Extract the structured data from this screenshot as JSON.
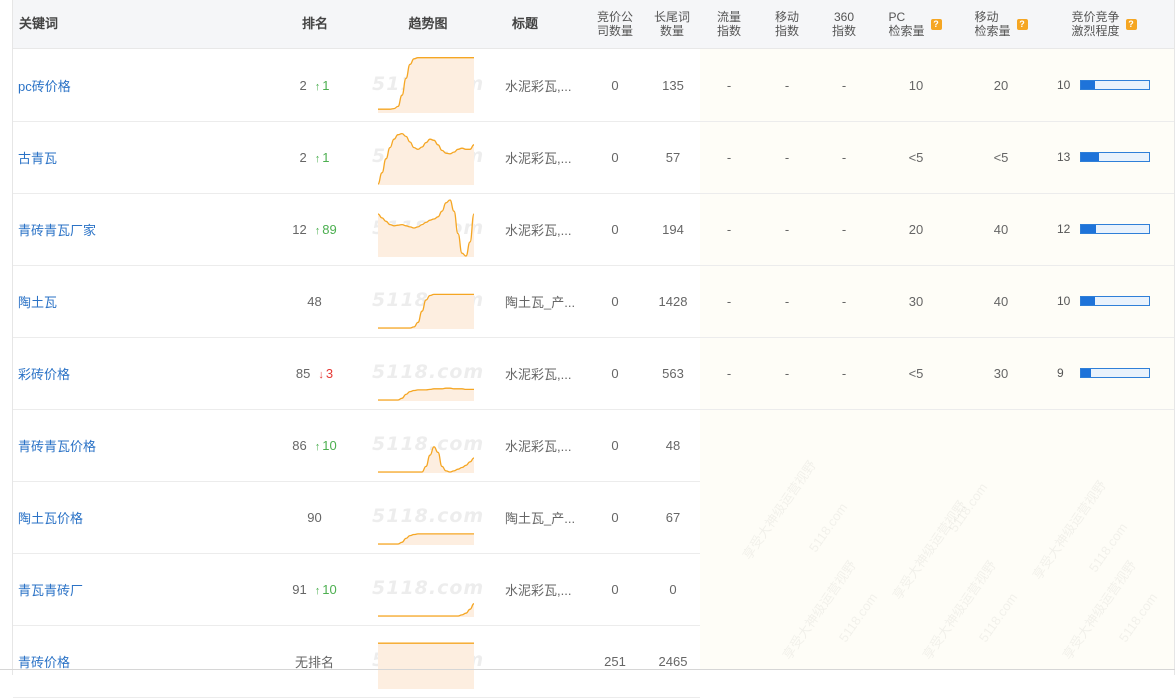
{
  "header": {
    "keyword": "关键词",
    "rank": "排名",
    "trend": "趋势图",
    "title": "标题",
    "competitors": "竞价公\n司数量",
    "longtail": "长尾词\n数量",
    "flow": "流量\n指数",
    "mobile_index": "移动\n指数",
    "index360": "360\n指数",
    "pc_search": "PC\n检索量",
    "mobile_search": "移动\n检索量",
    "competition": "竞价竞争\n激烈程度",
    "help_icon": "?"
  },
  "watermark": "5118.com",
  "bg_watermark": "享受大神级运营视野",
  "colors": {
    "link": "#2a72c6",
    "up": "#4caf50",
    "down": "#e53935",
    "bar": "#1e73d9",
    "trend": "#f5a623"
  },
  "rows": [
    {
      "keyword": "pc砖价格",
      "rank": "2",
      "dir": "up",
      "arrow": "↑",
      "delta": "1",
      "title": "水泥彩瓦,...",
      "competitors": "0",
      "longtail": "135",
      "flow": "-",
      "mobile": "-",
      "idx360": "-",
      "pc": "10",
      "mobs": "20",
      "comp": "10",
      "comp_level": 0.2,
      "trend": [
        0.05,
        0.05,
        0.05,
        0.05,
        0.06,
        0.1,
        0.3,
        0.6,
        0.85,
        0.95,
        0.97,
        0.97,
        0.97,
        0.97,
        0.97,
        0.97,
        0.97,
        0.97,
        0.97,
        0.97,
        0.97,
        0.97,
        0.97,
        0.97,
        0.97
      ]
    },
    {
      "keyword": "古青瓦",
      "rank": "2",
      "dir": "up",
      "arrow": "↑",
      "delta": "1",
      "title": "水泥彩瓦,...",
      "competitors": "0",
      "longtail": "57",
      "flow": "-",
      "mobile": "-",
      "idx360": "-",
      "pc": "<5",
      "mobs": "<5",
      "comp": "13",
      "comp_level": 0.26,
      "trend": [
        0.0,
        0.2,
        0.45,
        0.65,
        0.8,
        0.88,
        0.9,
        0.85,
        0.75,
        0.65,
        0.62,
        0.66,
        0.74,
        0.8,
        0.78,
        0.7,
        0.6,
        0.55,
        0.54,
        0.57,
        0.62,
        0.64,
        0.62,
        0.62,
        0.7
      ]
    },
    {
      "keyword": "青砖青瓦厂家",
      "rank": "12",
      "dir": "up",
      "arrow": "↑",
      "delta": "89",
      "title": "水泥彩瓦,...",
      "competitors": "0",
      "longtail": "194",
      "flow": "-",
      "mobile": "-",
      "idx360": "-",
      "pc": "20",
      "mobs": "40",
      "comp": "12",
      "comp_level": 0.22,
      "trend": [
        0.75,
        0.68,
        0.62,
        0.56,
        0.54,
        0.55,
        0.56,
        0.54,
        0.52,
        0.5,
        0.52,
        0.56,
        0.6,
        0.64,
        0.66,
        0.7,
        0.8,
        0.95,
        1.0,
        0.8,
        0.4,
        0.05,
        0.0,
        0.25,
        0.75
      ]
    },
    {
      "keyword": "陶土瓦",
      "rank": "48",
      "dir": "",
      "arrow": "",
      "delta": "",
      "title": "陶土瓦_产...",
      "competitors": "0",
      "longtail": "1428",
      "flow": "-",
      "mobile": "-",
      "idx360": "-",
      "pc": "30",
      "mobs": "40",
      "comp": "10",
      "comp_level": 0.2,
      "trend": [
        0.0,
        0.0,
        0.0,
        0.0,
        0.0,
        0.0,
        0.0,
        0.0,
        0.0,
        0.02,
        0.1,
        0.3,
        0.5,
        0.58,
        0.6,
        0.6,
        0.6,
        0.6,
        0.6,
        0.6,
        0.6,
        0.6,
        0.6,
        0.6,
        0.6
      ]
    },
    {
      "keyword": "彩砖价格",
      "rank": "85",
      "dir": "down",
      "arrow": "↓",
      "delta": "3",
      "title": "水泥彩瓦,...",
      "competitors": "0",
      "longtail": "563",
      "flow": "-",
      "mobile": "-",
      "idx360": "-",
      "pc": "<5",
      "mobs": "30",
      "comp": "9",
      "comp_level": 0.15,
      "trend": [
        0.0,
        0.0,
        0.0,
        0.0,
        0.0,
        0.0,
        0.03,
        0.1,
        0.15,
        0.17,
        0.18,
        0.18,
        0.18,
        0.19,
        0.2,
        0.2,
        0.2,
        0.21,
        0.21,
        0.2,
        0.2,
        0.2,
        0.19,
        0.19,
        0.19
      ]
    },
    {
      "keyword": "青砖青瓦价格",
      "rank": "86",
      "dir": "up",
      "arrow": "↑",
      "delta": "10",
      "title": "水泥彩瓦,...",
      "competitors": "0",
      "longtail": "48"
    },
    {
      "keyword": "陶土瓦价格",
      "rank": "90",
      "dir": "",
      "arrow": "",
      "delta": "",
      "title": "陶土瓦_产...",
      "competitors": "0",
      "longtail": "67"
    },
    {
      "keyword": "青瓦青砖厂",
      "rank": "91",
      "dir": "up",
      "arrow": "↑",
      "delta": "10",
      "title": "水泥彩瓦,...",
      "competitors": "0",
      "longtail": "0"
    },
    {
      "keyword": "青砖价格",
      "rank": "无排名",
      "dir": "",
      "arrow": "",
      "delta": "",
      "title": "",
      "competitors": "251",
      "longtail": "2465"
    }
  ],
  "extra_trends": [
    [
      0.0,
      0.0,
      0.0,
      0.0,
      0.0,
      0.0,
      0.0,
      0.0,
      0.0,
      0.0,
      0.0,
      0.0,
      0.1,
      0.3,
      0.45,
      0.35,
      0.1,
      0.02,
      0.0,
      0.02,
      0.05,
      0.08,
      0.12,
      0.18,
      0.25
    ],
    [
      0.0,
      0.0,
      0.0,
      0.0,
      0.0,
      0.0,
      0.03,
      0.1,
      0.15,
      0.17,
      0.18,
      0.18,
      0.18,
      0.18,
      0.18,
      0.18,
      0.18,
      0.18,
      0.18,
      0.18,
      0.18,
      0.18,
      0.18,
      0.18,
      0.18
    ],
    [
      0.0,
      0.0,
      0.0,
      0.0,
      0.0,
      0.0,
      0.0,
      0.0,
      0.0,
      0.0,
      0.0,
      0.0,
      0.0,
      0.0,
      0.0,
      0.0,
      0.0,
      0.0,
      0.0,
      0.0,
      0.0,
      0.02,
      0.05,
      0.12,
      0.22
    ],
    [
      0.8,
      0.8,
      0.8,
      0.8,
      0.8,
      0.8,
      0.8,
      0.8,
      0.8,
      0.8,
      0.8,
      0.8,
      0.8,
      0.8,
      0.8,
      0.8,
      0.8,
      0.8,
      0.8,
      0.8,
      0.8,
      0.8,
      0.8,
      0.8,
      0.8
    ]
  ]
}
